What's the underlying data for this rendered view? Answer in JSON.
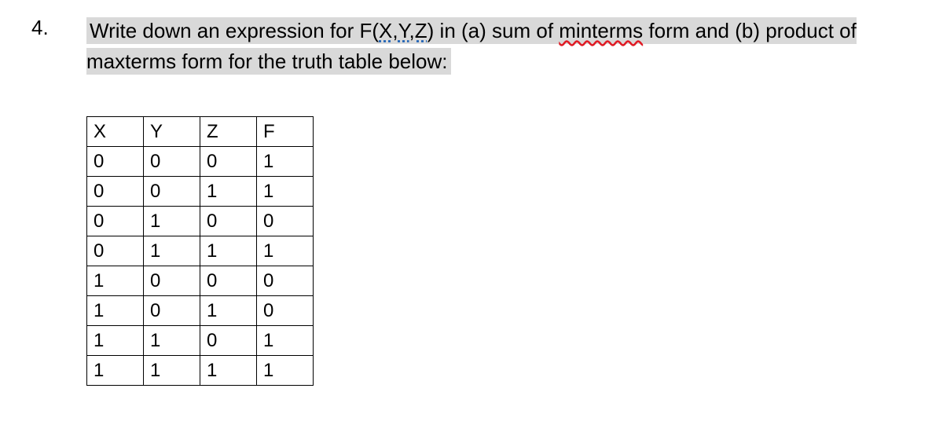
{
  "question_number": "4.",
  "question_text_part1": "Write down an expression for F(",
  "question_text_xyz": "X,Y,Z",
  "question_text_part2": ")  in (a) sum of ",
  "question_text_minterms": "minterms",
  "question_text_part3": " form and (b) product of maxterms form for the truth table below:",
  "table": {
    "headers": [
      "X",
      "Y",
      "Z",
      "F"
    ],
    "rows": [
      [
        "0",
        "0",
        "0",
        "1"
      ],
      [
        "0",
        "0",
        "1",
        "1"
      ],
      [
        "0",
        "1",
        "0",
        "0"
      ],
      [
        "0",
        "1",
        "1",
        "1"
      ],
      [
        "1",
        "0",
        "0",
        "0"
      ],
      [
        "1",
        "0",
        "1",
        "0"
      ],
      [
        "1",
        "1",
        "0",
        "1"
      ],
      [
        "1",
        "1",
        "1",
        "1"
      ]
    ]
  }
}
